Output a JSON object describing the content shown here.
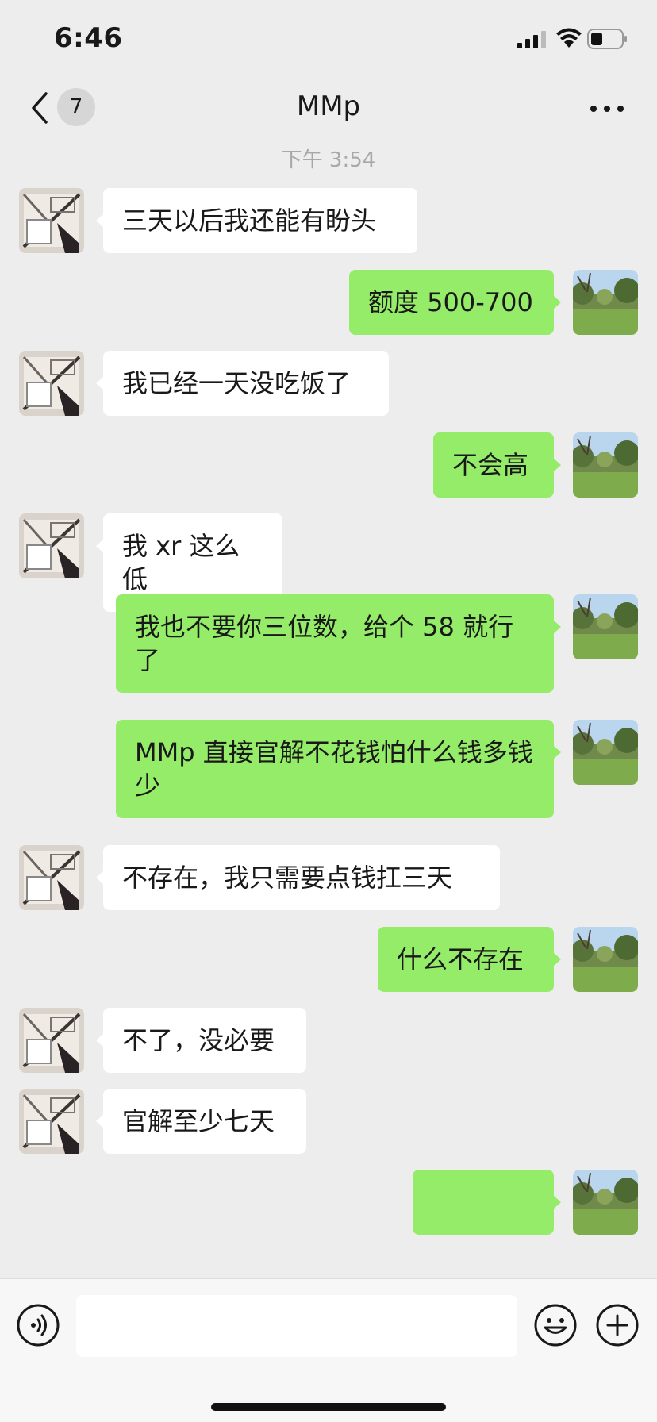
{
  "status_bar": {
    "time": "6:46"
  },
  "nav": {
    "unread_count": "7",
    "title": "MMp"
  },
  "chat": {
    "timestamp": "下午 3:54",
    "messages": [
      {
        "side": "in",
        "text": "三天以后我还能有盼头"
      },
      {
        "side": "out",
        "text": "额度 500-700"
      },
      {
        "side": "in",
        "text": "我已经一天没吃饭了"
      },
      {
        "side": "out",
        "text": "不会高"
      },
      {
        "side": "in",
        "text": "我 xr 这么低"
      },
      {
        "side": "out",
        "text": "我也不要你三位数，给个 58 就行了"
      },
      {
        "side": "out",
        "text": "MMp 直接官解不花钱怕什么钱多钱少"
      },
      {
        "side": "in",
        "text": "不存在，我只需要点钱扛三天"
      },
      {
        "side": "out",
        "text": "什么不存在"
      },
      {
        "side": "in",
        "text": "不了，没必要"
      },
      {
        "side": "in",
        "text": "官解至少七天"
      },
      {
        "side": "out",
        "text": ""
      }
    ]
  },
  "input": {
    "value": "",
    "placeholder": ""
  },
  "icons": {
    "back": "chevron-left-icon",
    "more": "more-dots-icon",
    "voice": "voice-icon",
    "emoji": "emoji-icon",
    "plus": "plus-icon"
  },
  "colors": {
    "background": "#ededed",
    "bubble_out": "#95ec69",
    "bubble_in": "#ffffff"
  }
}
